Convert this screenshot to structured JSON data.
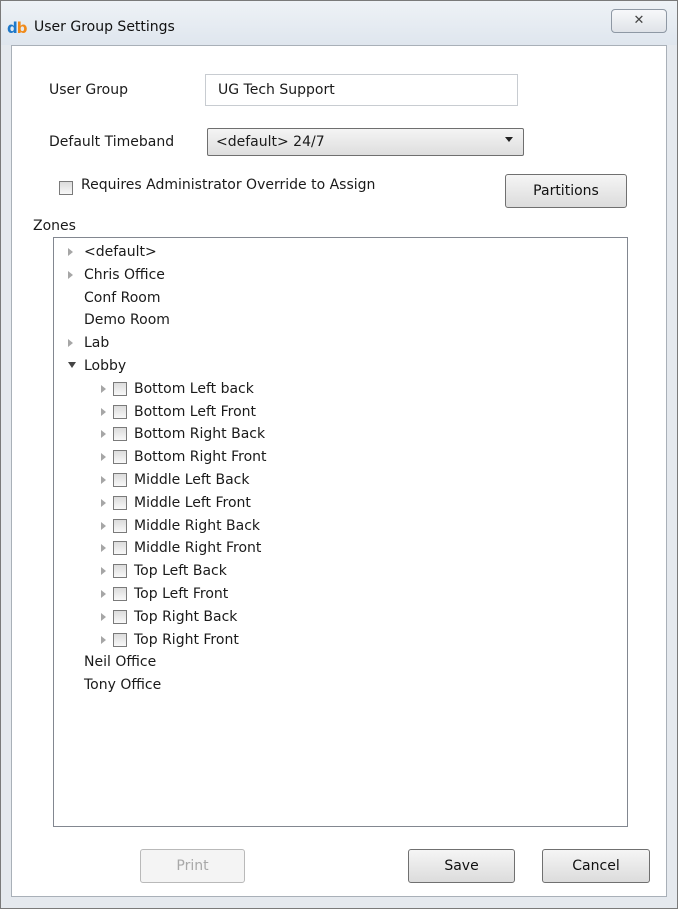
{
  "window": {
    "title": "User Group Settings",
    "close_glyph": "✕"
  },
  "app": {
    "logo_d": "d",
    "logo_b": "b"
  },
  "form": {
    "user_group_label": "User Group",
    "user_group_value": "UG Tech Support",
    "timeband_label": "Default Timeband",
    "timeband_value": "<default> 24/7",
    "override_label": "Requires Administrator Override to Assign",
    "override_checked": false,
    "partitions_button": "Partitions",
    "zones_label": "Zones"
  },
  "zones": {
    "top": [
      {
        "label": "<default>",
        "expander": "closed"
      },
      {
        "label": "Chris Office",
        "expander": "closed"
      },
      {
        "label": "Conf Room",
        "expander": "none"
      },
      {
        "label": "Demo Room",
        "expander": "none"
      },
      {
        "label": "Lab",
        "expander": "closed"
      },
      {
        "label": "Lobby",
        "expander": "open"
      }
    ],
    "lobby_children": [
      {
        "label": "Bottom Left back",
        "checked": false
      },
      {
        "label": "Bottom Left Front",
        "checked": false
      },
      {
        "label": "Bottom Right Back",
        "checked": false
      },
      {
        "label": "Bottom Right Front",
        "checked": false
      },
      {
        "label": "Middle Left Back",
        "checked": false
      },
      {
        "label": "Middle Left Front",
        "checked": false
      },
      {
        "label": "Middle Right Back",
        "checked": false
      },
      {
        "label": "Middle Right Front",
        "checked": false
      },
      {
        "label": "Top Left Back",
        "checked": false
      },
      {
        "label": "Top Left Front",
        "checked": false
      },
      {
        "label": "Top Right Back",
        "checked": false
      },
      {
        "label": "Top Right Front",
        "checked": false
      }
    ],
    "bottom": [
      {
        "label": "Neil Office",
        "expander": "none"
      },
      {
        "label": "Tony Office",
        "expander": "none"
      }
    ]
  },
  "footer": {
    "print_button": "Print",
    "print_enabled": false,
    "save_button": "Save",
    "cancel_button": "Cancel"
  },
  "colors": {
    "logo_d": "#1f79c9",
    "logo_b": "#f08a1a",
    "window_bg": "#e5e9ee"
  }
}
